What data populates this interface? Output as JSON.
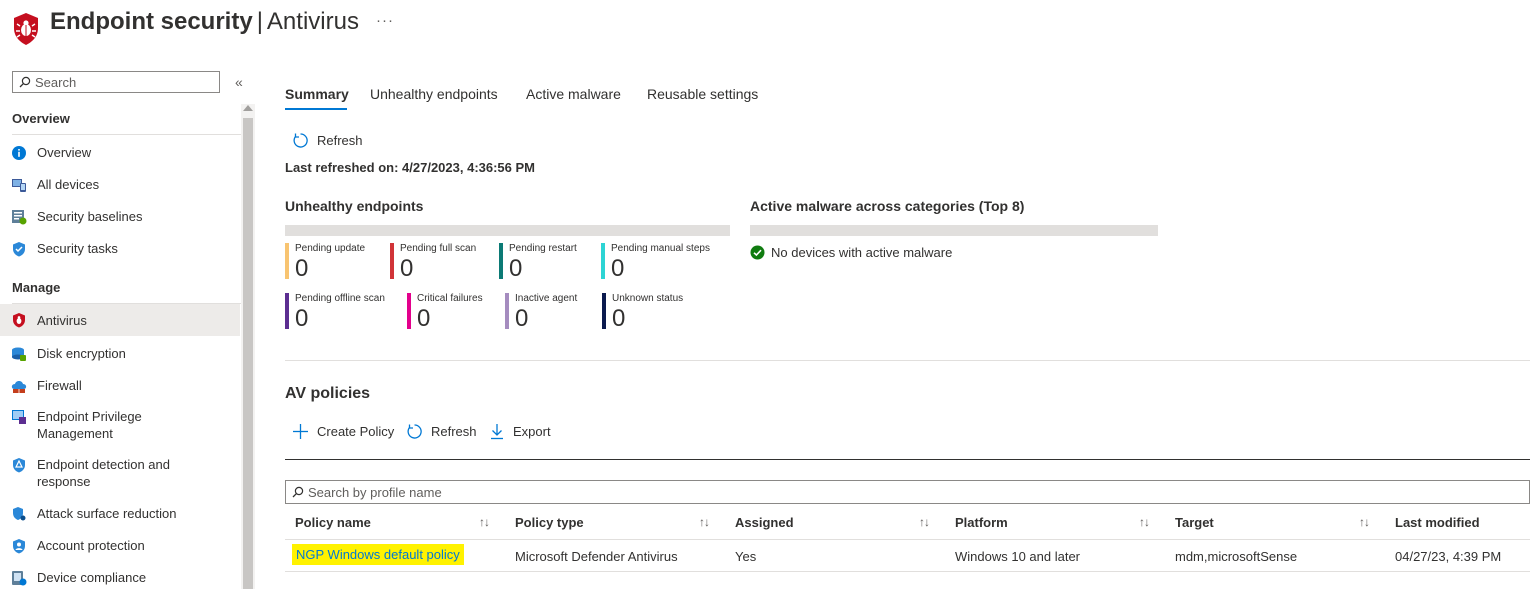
{
  "header": {
    "title": "Endpoint security",
    "separator": "|",
    "subtitle": "Antivirus",
    "more": "···"
  },
  "sidebar": {
    "search_placeholder": "Search",
    "collapse": "«",
    "sections": [
      {
        "title": "Overview",
        "items": [
          {
            "label": "Overview",
            "icon": "info-icon"
          },
          {
            "label": "All devices",
            "icon": "devices-icon"
          },
          {
            "label": "Security baselines",
            "icon": "baselines-icon"
          },
          {
            "label": "Security tasks",
            "icon": "security-tasks-icon"
          }
        ]
      },
      {
        "title": "Manage",
        "items": [
          {
            "label": "Antivirus",
            "icon": "antivirus-shield-icon",
            "active": true
          },
          {
            "label": "Disk encryption",
            "icon": "disk-encryption-icon"
          },
          {
            "label": "Firewall",
            "icon": "firewall-icon"
          },
          {
            "label": "Endpoint Privilege Management",
            "icon": "privilege-management-icon"
          },
          {
            "label": "Endpoint detection and response",
            "icon": "edr-icon"
          },
          {
            "label": "Attack surface reduction",
            "icon": "attack-surface-icon"
          },
          {
            "label": "Account protection",
            "icon": "account-protection-icon"
          },
          {
            "label": "Device compliance",
            "icon": "device-compliance-icon"
          }
        ]
      }
    ]
  },
  "tabs": [
    "Summary",
    "Unhealthy endpoints",
    "Active malware",
    "Reusable settings"
  ],
  "summary": {
    "refresh_label": "Refresh",
    "last_refreshed": "Last refreshed on: 4/27/2023, 4:36:56 PM",
    "unhealthy_title": "Unhealthy endpoints",
    "tiles": [
      {
        "label": "Pending update",
        "value": "0",
        "color": "#f8c471"
      },
      {
        "label": "Pending full scan",
        "value": "0",
        "color": "#d13438"
      },
      {
        "label": "Pending restart",
        "value": "0",
        "color": "#0b7a75"
      },
      {
        "label": "Pending manual steps",
        "value": "0",
        "color": "#2dd4d4"
      },
      {
        "label": "Pending offline scan",
        "value": "0",
        "color": "#5c2e91"
      },
      {
        "label": "Critical failures",
        "value": "0",
        "color": "#e3008c"
      },
      {
        "label": "Inactive agent",
        "value": "0",
        "color": "#a58cbf"
      },
      {
        "label": "Unknown status",
        "value": "0",
        "color": "#0b1a4e"
      }
    ],
    "malware_title": "Active malware across categories (Top 8)",
    "malware_status": "No devices with active malware"
  },
  "av_policies": {
    "title": "AV policies",
    "create_label": "Create Policy",
    "refresh_label": "Refresh",
    "export_label": "Export",
    "search_placeholder": "Search by profile name",
    "columns": [
      "Policy name",
      "Policy type",
      "Assigned",
      "Platform",
      "Target",
      "Last modified"
    ],
    "sort_glyph": "↑↓",
    "rows": [
      [
        "NGP Windows default policy",
        "Microsoft Defender Antivirus",
        "Yes",
        "Windows 10 and later",
        "mdm,microsoftSense",
        "04/27/23, 4:39 PM"
      ]
    ]
  },
  "colors": {
    "accent": "#0078d4",
    "highlight": "#fff200",
    "success": "#107c10",
    "brand_red": "#c50f1f"
  }
}
